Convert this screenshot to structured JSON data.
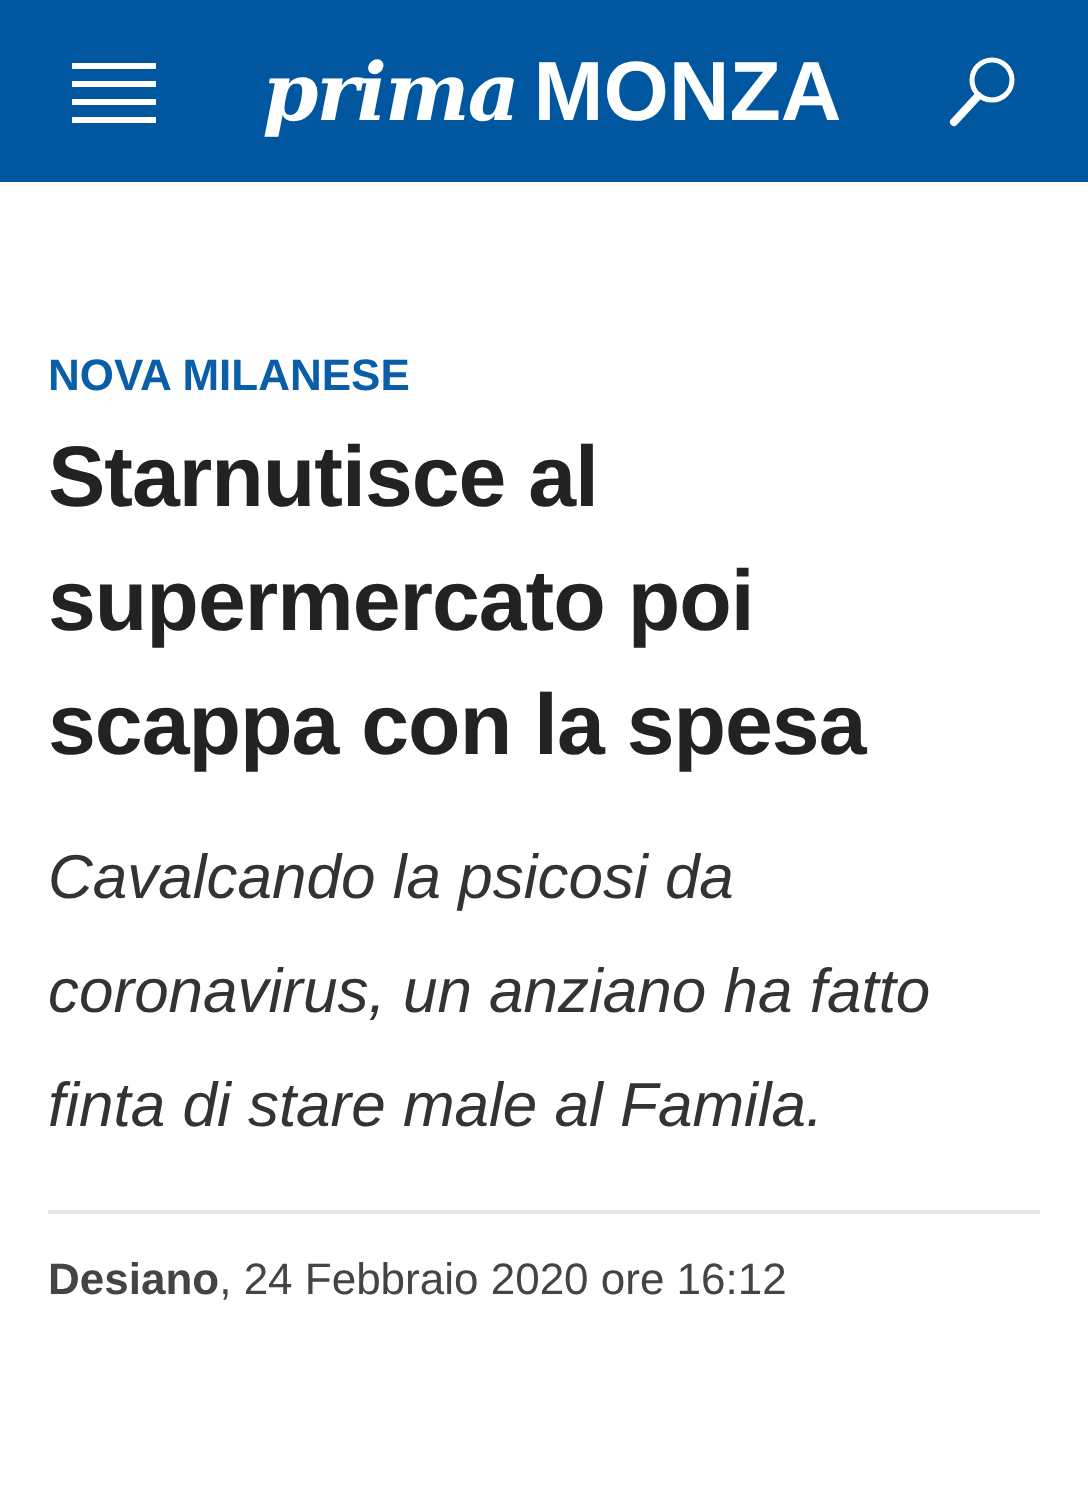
{
  "header": {
    "logo_script": "prima",
    "logo_bold": "MONZA"
  },
  "article": {
    "category": "NOVA MILANESE",
    "title": "Starnutisce al supermercato poi scappa con la spesa",
    "subtitle": "Cavalcando la psicosi da coronavirus, un anziano ha fatto finta di stare male al Famila.",
    "byline": "**Desiano**, 24 Febbraio 2020 ore 16:12"
  }
}
